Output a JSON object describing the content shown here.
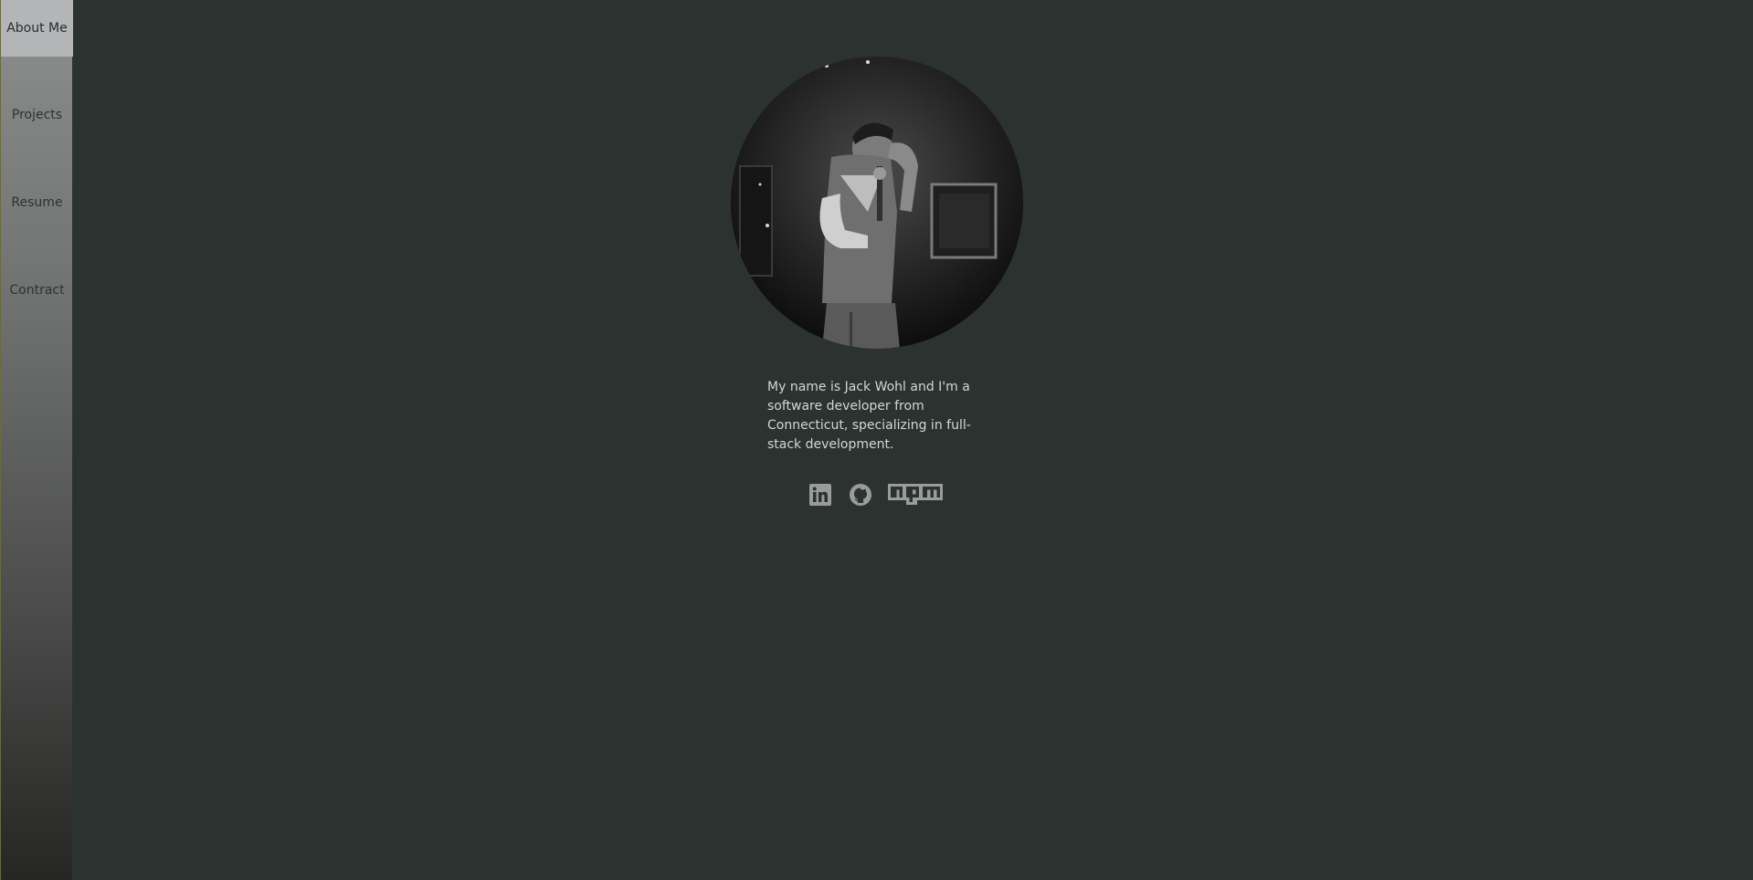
{
  "nav": {
    "items": [
      {
        "label": "About Me",
        "active": true
      },
      {
        "label": "Projects",
        "active": false
      },
      {
        "label": "Resume",
        "active": false
      },
      {
        "label": "Contract",
        "active": false
      }
    ]
  },
  "profile": {
    "photo_icon": "profile-photo",
    "bio": "My name is Jack Wohl and I'm a software developer from Connecticut, specializing in full-stack development."
  },
  "socials": [
    {
      "icon": "linkedin-icon"
    },
    {
      "icon": "github-icon"
    },
    {
      "icon": "npm-icon"
    }
  ],
  "colors": {
    "background": "#2b322f",
    "icon": "#9a9c9c",
    "text": "#d4d6d4",
    "nav_active": "#b3b5b7"
  }
}
